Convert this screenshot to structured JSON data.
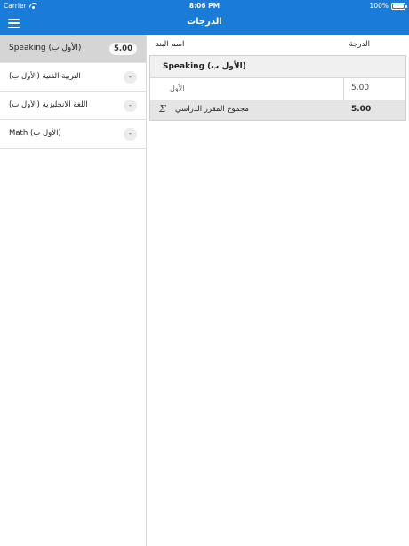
{
  "status_bar": {
    "carrier": "Carrier",
    "time": "8:06 PM",
    "battery": "100%"
  },
  "nav": {
    "title": "الدرجات"
  },
  "sidebar": {
    "items": [
      {
        "label": "Speaking (الأول ب)",
        "badge": "5.00",
        "active": true
      },
      {
        "label": "(التربية الفنية (الأول ب",
        "badge": "-"
      },
      {
        "label": "(اللغة الانجليزية (الأول ب",
        "badge": "-"
      },
      {
        "label": "Math (الأول ب)",
        "badge": "-"
      }
    ]
  },
  "main": {
    "columns": {
      "name": "اسم البند",
      "grade": "الدرجة"
    },
    "group": {
      "label": "Speaking (الأول ب)"
    },
    "item": {
      "name": "الأول",
      "grade": "5.00"
    },
    "total": {
      "symbol": "Σ",
      "label": "مجموع المقرر الدراسي",
      "grade": "5.00"
    }
  },
  "colors": {
    "accent": "#1b7bd8",
    "active_row": "#d5d5d5"
  }
}
